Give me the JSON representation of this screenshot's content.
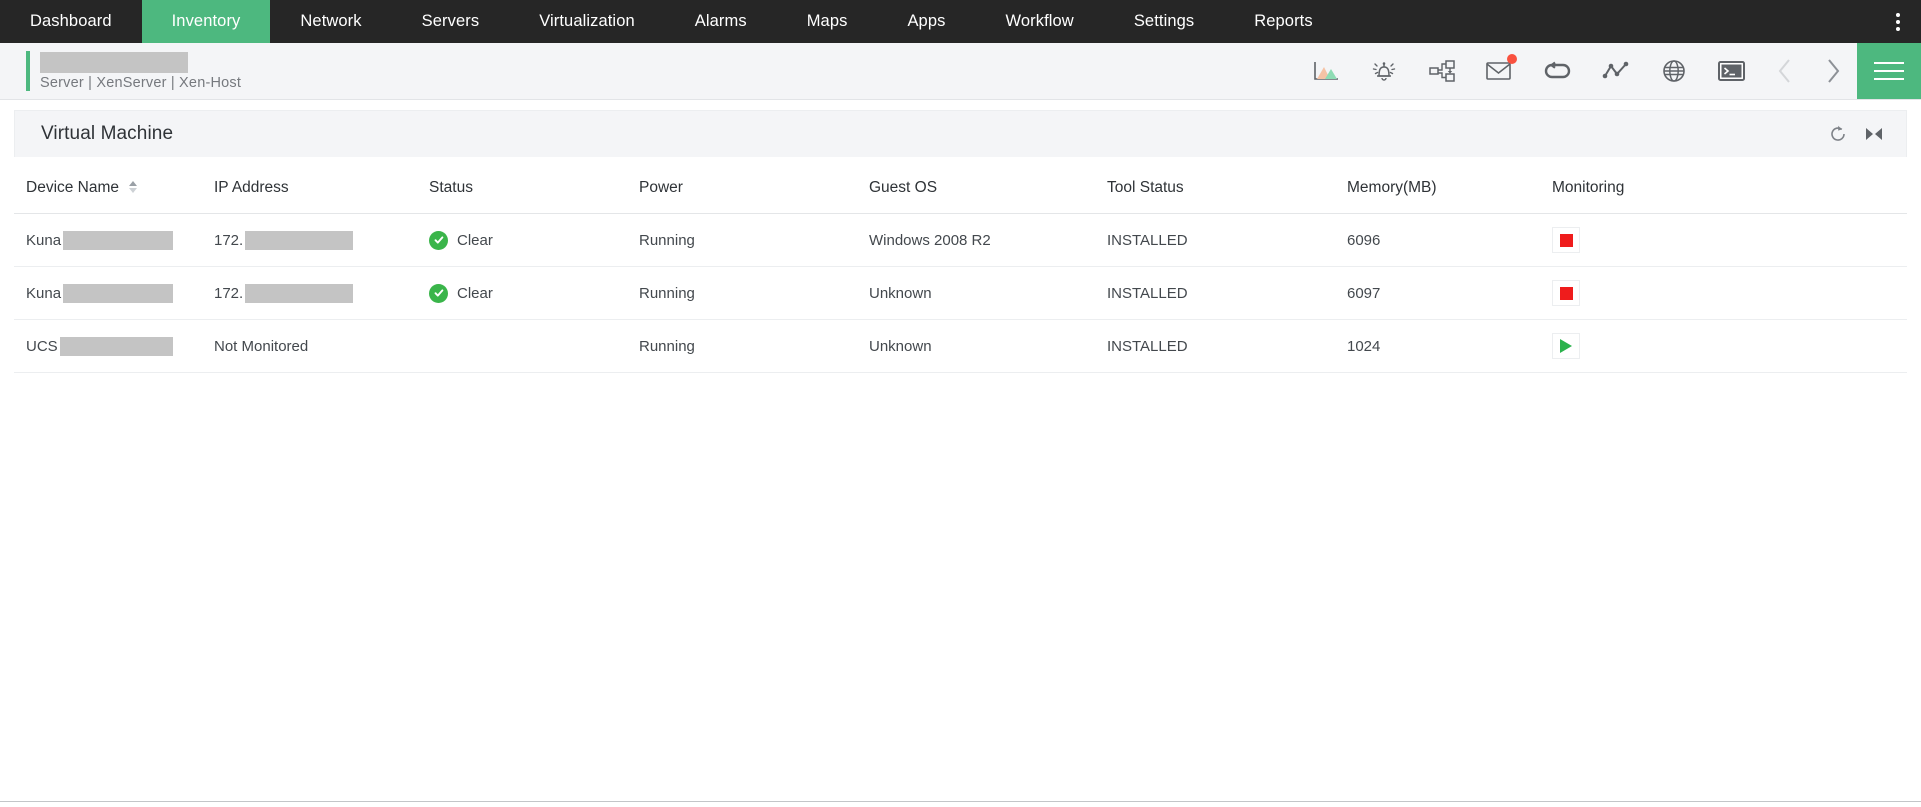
{
  "nav": {
    "items": [
      {
        "label": "Dashboard",
        "active": false
      },
      {
        "label": "Inventory",
        "active": true
      },
      {
        "label": "Network",
        "active": false
      },
      {
        "label": "Servers",
        "active": false
      },
      {
        "label": "Virtualization",
        "active": false
      },
      {
        "label": "Alarms",
        "active": false
      },
      {
        "label": "Maps",
        "active": false
      },
      {
        "label": "Apps",
        "active": false
      },
      {
        "label": "Workflow",
        "active": false
      },
      {
        "label": "Settings",
        "active": false
      },
      {
        "label": "Reports",
        "active": false
      }
    ],
    "kebab_icon": "more-vertical-icon",
    "active_color": "#4db87f",
    "background_color": "#262626"
  },
  "breadcrumb": {
    "title_redacted": true,
    "path": "Server | XenServer | Xen-Host",
    "accent_color": "#4db87f"
  },
  "toolbar": {
    "icons": [
      {
        "name": "area-chart-icon"
      },
      {
        "name": "alarm-bell-icon"
      },
      {
        "name": "workflow-icon"
      },
      {
        "name": "mail-icon",
        "badge": true,
        "badge_color": "#f9513f"
      },
      {
        "name": "link-loop-icon"
      },
      {
        "name": "line-chart-icon"
      },
      {
        "name": "globe-icon"
      },
      {
        "name": "terminal-icon"
      }
    ],
    "prev_arrow": "chevron-left-icon",
    "next_arrow": "chevron-right-icon",
    "prev_disabled": true,
    "menu_icon": "hamburger-menu-icon",
    "menu_color": "#4db87f"
  },
  "card": {
    "title": "Virtual Machine",
    "refresh_icon": "refresh-icon",
    "expand_icon": "collapse-expand-icon"
  },
  "table": {
    "columns": [
      {
        "label": "Device Name",
        "sortable": true,
        "sorted": "asc"
      },
      {
        "label": "IP Address",
        "sortable": false
      },
      {
        "label": "Status",
        "sortable": false
      },
      {
        "label": "Power",
        "sortable": false
      },
      {
        "label": "Guest OS",
        "sortable": false
      },
      {
        "label": "Tool Status",
        "sortable": false
      },
      {
        "label": "Memory(MB)",
        "sortable": false
      },
      {
        "label": "Monitoring",
        "sortable": false
      }
    ],
    "rows": [
      {
        "device_name_prefix": "Kuna",
        "device_name_redacted": true,
        "ip_prefix": "172.",
        "ip_redacted": true,
        "status": "Clear",
        "status_icon": "check-circle-icon",
        "power": "Running",
        "guest_os": "Windows 2008 R2",
        "tool_status": "INSTALLED",
        "memory": "6096",
        "monitoring_icon": "stop-square-icon",
        "monitoring_color": "#ef1c1c"
      },
      {
        "device_name_prefix": "Kuna",
        "device_name_redacted": true,
        "ip_prefix": "172.",
        "ip_redacted": true,
        "status": "Clear",
        "status_icon": "check-circle-icon",
        "power": "Running",
        "guest_os": "Unknown",
        "tool_status": "INSTALLED",
        "memory": "6097",
        "monitoring_icon": "stop-square-icon",
        "monitoring_color": "#ef1c1c"
      },
      {
        "device_name_prefix": "UCS",
        "device_name_redacted": true,
        "ip_prefix": "Not Monitored",
        "ip_redacted": false,
        "status": "",
        "status_icon": null,
        "power": "Running",
        "guest_os": "Unknown",
        "tool_status": "INSTALLED",
        "memory": "1024",
        "monitoring_icon": "play-triangle-icon",
        "monitoring_color": "#2bb24c"
      }
    ]
  }
}
